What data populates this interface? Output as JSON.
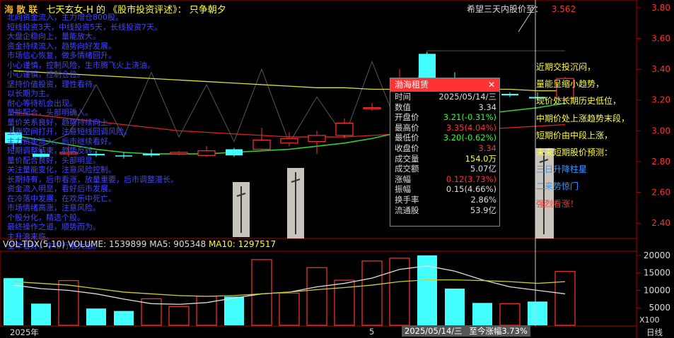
{
  "banner": {
    "logo": "海 散 联",
    "logo_decor": "$\\$",
    "text": "七天玄女-H 的 《股市投资评述》： 只争朝夕"
  },
  "expect": {
    "label": "希望三天内股价至：",
    "value": "3.562"
  },
  "overlay_lines": [
    "北向资金流入，主力增仓800股。",
    "短线投资3天，中线投资5天，长线投资7天。",
    "大盘企稳向上，量能放大。",
    "资金持续流入，趋势向好发展。",
    "市场信心恢复，做多情绪回升。",
    "小心谨慎，控制风险，生市腾飞火上浇油。",
    "小心谨慎，控制仓位。",
    "坚持价值投资，理性看待。",
    "以长期为主。",
    "耐心等待机会出现。",
    "量能配合，头部明确入。",
    "量价关系良好，趋势持续向上。",
    "上涨空间打开，注意短线回调风险。",
    "主力资金流入，后市继续看好。",
    "短期调整结束，趋势反转。",
    "量价配合良好，头部明显。",
    "关注量能变化，注意风险控制。",
    "长期持有，后市看涨，放量重要，后市调整漫长。",
    "资金流入明显，看好后市发展。",
    "在冷落中发展，在欢乐中死亡。",
    "市场情绪高涨，注意风险。",
    "个股分化，精选个股。",
    "最终操作之道，顺势而为。",
    "主升浪来临。",
    "全年看好，牛市行情大涨。"
  ],
  "side_notes": [
    {
      "text": "近期交投沉闷，",
      "tone": "y"
    },
    {
      "text": "量能呈缩小趋势，",
      "tone": "y"
    },
    {
      "text": "现价处长期历史低位，",
      "tone": "y"
    },
    {
      "text": "中期价处上涨趋势末段，",
      "tone": "y"
    },
    {
      "text": "短期价由中段上涨，",
      "tone": "y"
    },
    {
      "text": "未来短期股价预测：",
      "tone": "y"
    },
    {
      "text": "三日升降柱星",
      "tone": "c"
    },
    {
      "text": "二来势惊门",
      "tone": "c"
    },
    {
      "text": "强烈看涨！",
      "tone": "r"
    }
  ],
  "popup": {
    "title": "渤海租赁",
    "close": "✕",
    "rows": [
      {
        "k": "时间",
        "v": "2025/05/14/三",
        "tone": ""
      },
      {
        "k": "数值",
        "v": "3.34",
        "tone": ""
      },
      {
        "k": "开盘价",
        "v": "3.21(-0.31%)",
        "tone": "g"
      },
      {
        "k": "最高价",
        "v": "3.35(4.04%)",
        "tone": "r"
      },
      {
        "k": "最低价",
        "v": "3.20(-0.62%)",
        "tone": "g"
      },
      {
        "k": "收盘价",
        "v": "3.34",
        "tone": "r"
      },
      {
        "k": "成交量",
        "v": "154.0万",
        "tone": "y"
      },
      {
        "k": "成交额",
        "v": "5.07亿",
        "tone": ""
      },
      {
        "k": "涨幅",
        "v": "0.12(3.73%)",
        "tone": "r"
      },
      {
        "k": "振幅",
        "v": "0.15(4.66%)",
        "tone": ""
      },
      {
        "k": "换手率",
        "v": "2.86%",
        "tone": ""
      },
      {
        "k": "流通股",
        "v": "53.9亿",
        "tone": ""
      }
    ]
  },
  "price_axis": [
    "3.80",
    "3.60",
    "3.40",
    "3.20",
    "3.00",
    "2.80",
    "2.60",
    "2.40"
  ],
  "vol_header": {
    "name": "VOL-TDX(5,10)",
    "volume": "VOLUME: 1539899",
    "ma5": "MA5: 905348",
    "ma10": "MA10: 1297517"
  },
  "vol_axis": [
    "20000",
    "15000",
    "10000",
    "5000"
  ],
  "vol_unit": "X100",
  "footer": {
    "year": "2025年",
    "month": "5",
    "date_box": "2025/05/14/三",
    "change": "至今涨幅3.73%",
    "period": "日线"
  },
  "chart_data": {
    "type": "candlestick",
    "price_range": [
      2.3,
      3.85
    ],
    "candles": [
      {
        "o": 2.99,
        "c": 2.92,
        "h": 3.03,
        "l": 2.88,
        "dir": "down"
      },
      {
        "o": 2.85,
        "c": 2.83,
        "h": 2.88,
        "l": 2.82,
        "dir": "down"
      },
      {
        "o": 2.85,
        "c": 2.86,
        "h": 2.9,
        "l": 2.83,
        "dir": "up"
      },
      {
        "o": 2.85,
        "c": 2.84,
        "h": 2.87,
        "l": 2.83,
        "dir": "down"
      },
      {
        "o": 2.84,
        "c": 2.84,
        "h": 2.86,
        "l": 2.82,
        "dir": "down"
      },
      {
        "o": 2.85,
        "c": 2.84,
        "h": 2.88,
        "l": 2.83,
        "dir": "down"
      },
      {
        "o": 2.85,
        "c": 2.86,
        "h": 2.87,
        "l": 2.84,
        "dir": "up"
      },
      {
        "o": 2.84,
        "c": 2.87,
        "h": 2.9,
        "l": 2.83,
        "dir": "up"
      },
      {
        "o": 2.88,
        "c": 2.84,
        "h": 2.89,
        "l": 2.83,
        "dir": "down"
      },
      {
        "o": 2.88,
        "c": 2.94,
        "h": 3.02,
        "l": 2.87,
        "dir": "up"
      },
      {
        "o": 2.92,
        "c": 2.95,
        "h": 2.99,
        "l": 2.9,
        "dir": "up"
      },
      {
        "o": 2.93,
        "c": 2.97,
        "h": 3.0,
        "l": 2.85,
        "dir": "up"
      },
      {
        "o": 2.97,
        "c": 3.05,
        "h": 3.08,
        "l": 2.95,
        "dir": "up"
      },
      {
        "o": 3.15,
        "c": 3.15,
        "h": 3.18,
        "l": 3.13,
        "dir": "up"
      },
      {
        "o": 3.17,
        "c": 3.34,
        "h": 3.4,
        "l": 3.16,
        "dir": "up"
      },
      {
        "o": 3.27,
        "c": 3.5,
        "h": 3.51,
        "l": 3.27,
        "dir": "down"
      },
      {
        "o": 3.3,
        "c": 3.23,
        "h": 3.38,
        "l": 3.22,
        "dir": "down"
      },
      {
        "o": 3.26,
        "c": 3.24,
        "h": 3.28,
        "l": 3.22,
        "dir": "down"
      },
      {
        "o": 3.24,
        "c": 3.23,
        "h": 3.25,
        "l": 3.22,
        "dir": "down"
      },
      {
        "o": 3.22,
        "c": 3.21,
        "h": 3.25,
        "l": 3.2,
        "dir": "down"
      },
      {
        "o": 3.21,
        "c": 3.34,
        "h": 3.35,
        "l": 3.2,
        "dir": "up"
      }
    ],
    "ma_yellow": [
      3.39,
      3.38,
      3.37,
      3.36,
      3.35,
      3.34,
      3.33,
      3.32,
      3.31,
      3.3,
      3.29,
      3.28,
      3.28,
      3.27,
      3.27,
      3.28,
      3.28,
      3.27,
      3.27,
      3.26,
      3.26
    ],
    "ma_red": [
      3.12,
      3.1,
      3.08,
      3.06,
      3.04,
      3.02,
      3.0,
      2.99,
      2.98,
      2.97,
      2.96,
      2.96,
      2.96,
      2.97,
      2.98,
      2.99,
      3.0,
      3.01,
      3.02,
      3.03,
      3.04
    ],
    "ma_green": [
      2.97,
      2.94,
      2.91,
      2.88,
      2.86,
      2.85,
      2.85,
      2.85,
      2.86,
      2.87,
      2.88,
      2.9,
      2.92,
      2.95,
      2.99,
      3.04,
      3.08,
      3.11,
      3.13,
      3.15,
      3.18
    ],
    "ma_black": [
      2.96,
      2.9,
      2.98,
      3.3,
      2.96,
      3.38,
      2.96,
      3.3,
      2.93,
      3.4,
      2.92,
      3.22,
      2.96,
      3.45,
      3.0,
      3.52,
      3.52,
      3.52,
      3.52,
      3.52,
      3.52
    ],
    "volumes": [
      {
        "v": 13500,
        "dir": "down"
      },
      {
        "v": 6200,
        "dir": "down"
      },
      {
        "v": 12800,
        "dir": "up"
      },
      {
        "v": 4800,
        "dir": "down"
      },
      {
        "v": 4100,
        "dir": "down"
      },
      {
        "v": 7600,
        "dir": "up"
      },
      {
        "v": 5400,
        "dir": "up"
      },
      {
        "v": 8300,
        "dir": "up"
      },
      {
        "v": 8200,
        "dir": "down"
      },
      {
        "v": 18800,
        "dir": "up"
      },
      {
        "v": 9200,
        "dir": "up"
      },
      {
        "v": 16500,
        "dir": "up"
      },
      {
        "v": 12900,
        "dir": "up"
      },
      {
        "v": 18400,
        "dir": "up"
      },
      {
        "v": 19200,
        "dir": "up"
      },
      {
        "v": 20000,
        "dir": "down"
      },
      {
        "v": 10500,
        "dir": "down"
      },
      {
        "v": 6400,
        "dir": "down"
      },
      {
        "v": 6200,
        "dir": "up"
      },
      {
        "v": 6800,
        "dir": "down"
      },
      {
        "v": 15400,
        "dir": "up"
      }
    ],
    "vol_ma_white": [
      11500,
      10500,
      10000,
      9000,
      7500,
      6200,
      6000,
      6500,
      7800,
      9000,
      9500,
      11000,
      12000,
      13500,
      16000,
      17000,
      15500,
      13000,
      11000,
      10000,
      9000
    ],
    "vol_ma_yellow": [
      12500,
      12000,
      11500,
      10500,
      9500,
      9000,
      8500,
      8300,
      8500,
      9000,
      9500,
      10200,
      10800,
      11500,
      12500,
      13000,
      13000,
      12800,
      12500,
      12000,
      12500
    ],
    "vol_range": [
      0,
      21000
    ]
  }
}
